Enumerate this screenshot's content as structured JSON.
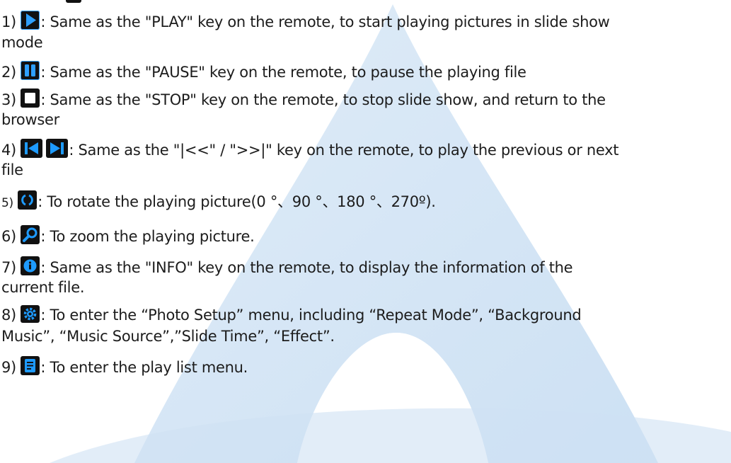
{
  "items": [
    {
      "num": "1)",
      "text": ": Same as the \"PLAY\" key on the remote, to start playing pictures in slide show",
      "cont": "mode",
      "icon": "play-icon"
    },
    {
      "num": "2)",
      "text": ": Same as the \"PAUSE\" key on the remote, to pause the playing file",
      "icon": "pause-icon"
    },
    {
      "num": "3)",
      "text": ": Same as the \"STOP\" key on the remote, to stop slide show, and return to the",
      "cont": "browser",
      "icon": "stop-icon"
    },
    {
      "num": "4)",
      "text": ": Same as the \"|<<\" / \">>|\" key on the remote, to play the previous or next",
      "cont": "file",
      "icon": "previous-next-icon"
    },
    {
      "num": "5)",
      "text": ": To rotate the playing picture(0 °、90 °、180 °、270º).",
      "icon": "rotate-icon"
    },
    {
      "num": "6)",
      "text": ": To zoom the playing picture.",
      "icon": "zoom-icon"
    },
    {
      "num": "7)",
      "text": ": Same as the \"INFO\" key on the remote, to display the information of the",
      "cont": "current file.",
      "icon": "info-icon"
    },
    {
      "num": "8)",
      "text": ": To enter the “Photo Setup” menu, including “Repeat Mode”, “Background",
      "cont": "Music”, “Music Source”,”Slide Time”, “Effect”.",
      "icon": "gear-icon"
    },
    {
      "num": "9)",
      "text": ": To enter the play list menu.",
      "icon": "playlist-icon"
    }
  ],
  "colors": {
    "text": "#1c1c1c",
    "icon_bg": "#111111",
    "icon_fg": "#1e9bff",
    "watermark": "#cfe3f5"
  }
}
